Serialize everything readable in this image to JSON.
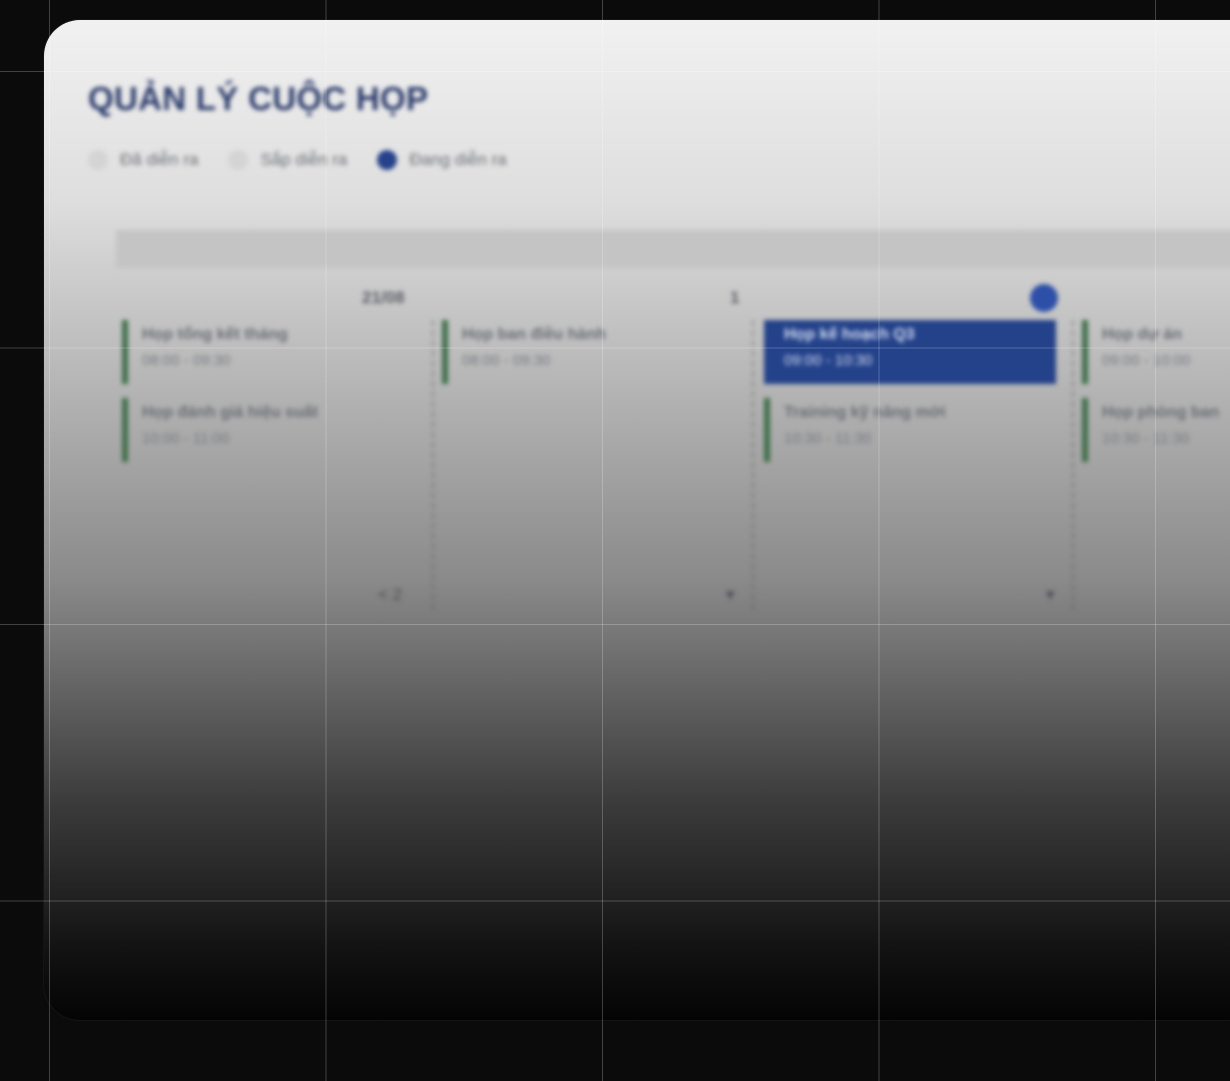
{
  "page": {
    "title": "QUẢN LÝ CUỘC HỌP"
  },
  "legend": [
    {
      "label": "Đã diễn ra",
      "state": "inactive"
    },
    {
      "label": "Sắp diễn ra",
      "state": "inactive"
    },
    {
      "label": "Đang diễn ra",
      "state": "active"
    }
  ],
  "columns": [
    {
      "head": "21/08",
      "foot": "< 2"
    },
    {
      "head": "",
      "foot": ""
    },
    {
      "head": "",
      "foot": ""
    },
    {
      "head": "",
      "foot": ""
    }
  ],
  "events": [
    {
      "name": "Họp tổng kết tháng",
      "time": "08:00 - 09:30",
      "state": "normal"
    },
    {
      "name": "Họp ban điều hành",
      "time": "08:00 - 09:30",
      "state": "normal"
    },
    {
      "name": "Họp kế hoạch Q3",
      "time": "09:00 - 10:30",
      "state": "selected"
    },
    {
      "name": "Họp dự án",
      "time": "09:00 - 10:00",
      "state": "normal"
    },
    {
      "name": "Họp đánh giá hiệu suất",
      "time": "10:00 - 11:00",
      "state": "normal"
    },
    {
      "name": "Training kỹ năng mới",
      "time": "10:30 - 11:30",
      "state": "normal"
    },
    {
      "name": "Họp phòng ban",
      "time": "10:30 - 11:30",
      "state": "normal"
    }
  ],
  "colors": {
    "accent": "#26418a",
    "event_bar": "#3f6f4a",
    "title": "#2a3a6a"
  }
}
